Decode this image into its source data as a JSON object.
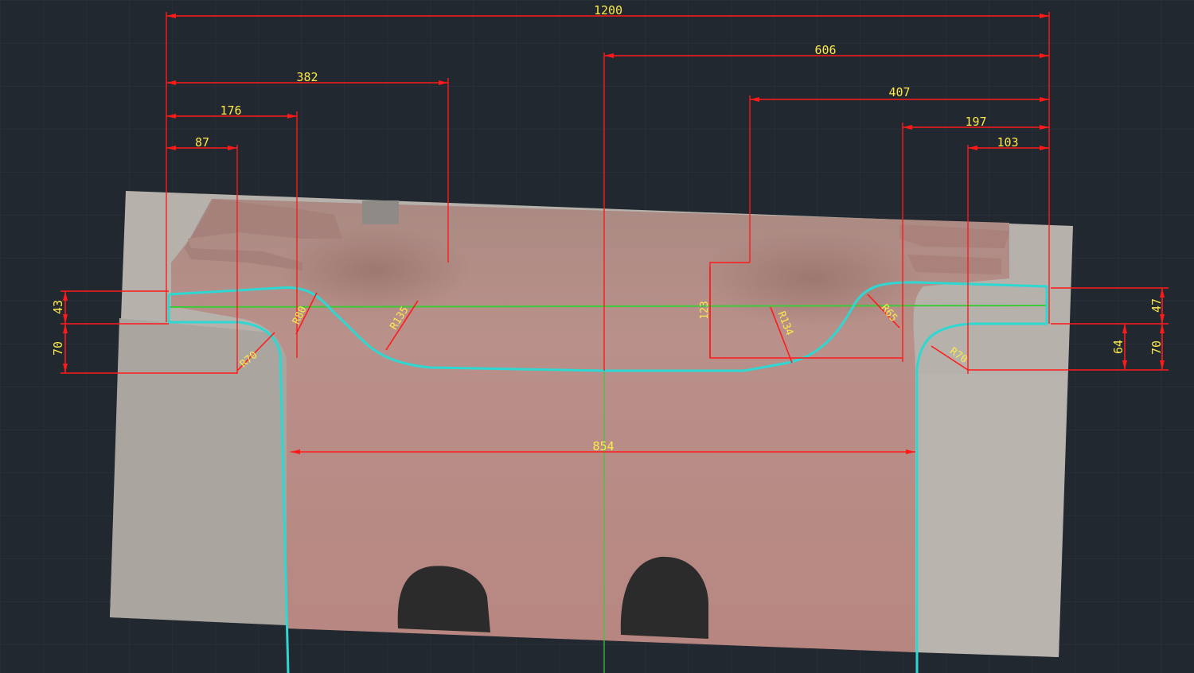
{
  "drawing": {
    "colors": {
      "background": "#212830",
      "grid": "#2c3440",
      "dimension": "#ff1a1a",
      "dimension_text": "#ffe94a",
      "profile": "#2ed8d2",
      "axis": "#3ec93a",
      "concrete": "#b6b2ab",
      "stone": "#b48a82"
    },
    "dimensions": {
      "overall": "1200",
      "right_to_center": "606",
      "left_382": "382",
      "left_176": "176",
      "left_87": "87",
      "right_407": "407",
      "right_197": "197",
      "right_103": "103",
      "bottom_width": "854",
      "left_vert_top": "43",
      "left_vert_bottom": "70",
      "right_vert_top": "47",
      "right_vert_mid": "64",
      "right_vert_bottom": "70",
      "center_vert": "123"
    },
    "radii": {
      "left_outer": "R70",
      "left_inner": "R80",
      "left_mid": "R135",
      "right_mid": "R134",
      "right_inner": "R65",
      "right_outer": "R70"
    }
  }
}
